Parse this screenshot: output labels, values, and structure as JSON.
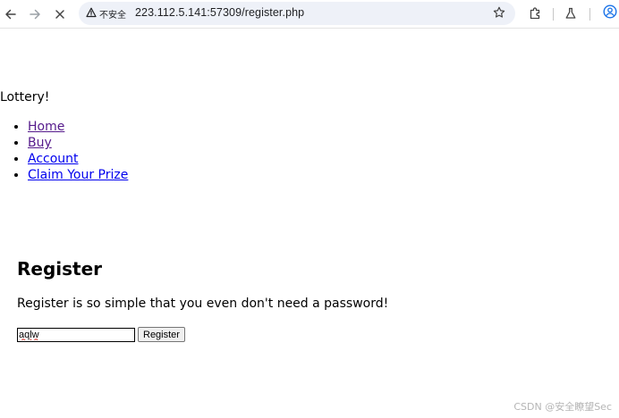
{
  "browser": {
    "security_label": "不安全",
    "url": "223.112.5.141:57309/register.php",
    "icons": {
      "back": "arrow-left-icon",
      "forward": "arrow-right-icon",
      "stop": "close-icon",
      "warning": "warning-triangle-icon",
      "bookmark": "star-icon",
      "extensions": "puzzle-icon",
      "labs": "flask-icon",
      "profile": "user-circle-icon"
    },
    "accent_color": "#1a73e8"
  },
  "page": {
    "site_title": "Lottery!",
    "nav": [
      {
        "label": "Home"
      },
      {
        "label": "Buy"
      },
      {
        "label": "Account"
      },
      {
        "label": "Claim Your Prize"
      }
    ],
    "heading": "Register",
    "description": "Register is so simple that you even don't need a password!",
    "form": {
      "username_value": "aqlw",
      "submit_label": "Register"
    },
    "link_color": "#0000ee",
    "visited_link_color": "#551a8b"
  },
  "watermark": "CSDN @安全瞭望Sec"
}
